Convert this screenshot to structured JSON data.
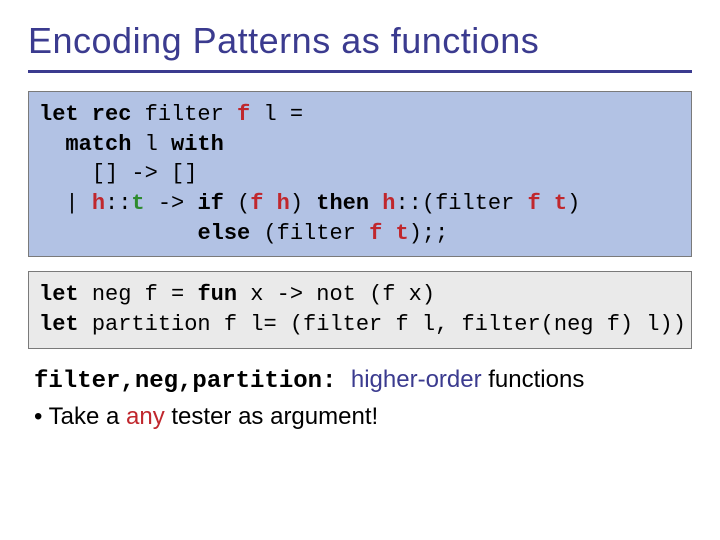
{
  "title": "Encoding Patterns as functions",
  "code1": {
    "l1a": "let rec",
    "l1b": " filter ",
    "l1c": "f",
    "l1d": " l = ",
    "l2a": "  match",
    "l2b": " l ",
    "l2c": "with",
    "l2d": "",
    "l3": "    [] -> []",
    "l4a": "  | ",
    "l4b": "h",
    "l4c": "::",
    "l4d": "t",
    "l4e": " -> ",
    "l4f": "if",
    "l4g": " (",
    "l4h": "f h",
    "l4i": ") ",
    "l4j": "then",
    "l4k": " ",
    "l4l": "h",
    "l4m": "::(filter ",
    "l4n": "f t",
    "l4o": ")",
    "l5a": "            ",
    "l5b": "else",
    "l5c": " (filter ",
    "l5d": "f t",
    "l5e": ");;"
  },
  "code2": {
    "l1a": "let ",
    "l1b": "neg f = ",
    "l1c": "fun",
    "l1d": " x -> not (f x)",
    "l2a": "let ",
    "l2b": "partition f l= (filter f l, filter(neg f) l))"
  },
  "notes": {
    "line1_code": "filter,neg,partition:  ",
    "line1_tail_a": "higher-order",
    "line1_tail_b": " functions",
    "line2_a": "• Take a ",
    "line2_b": "any",
    "line2_c": " tester as argument!"
  }
}
